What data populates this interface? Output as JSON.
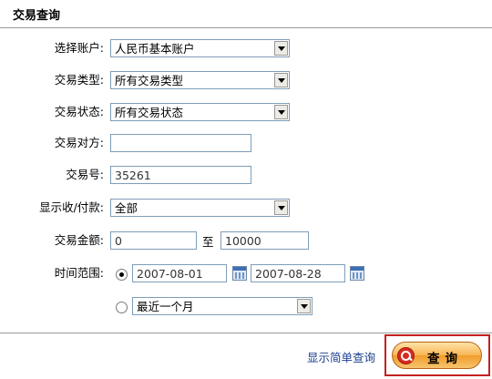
{
  "header": {
    "title": "交易查询"
  },
  "form": {
    "account": {
      "label": "选择账户:",
      "value": "人民币基本账户"
    },
    "trade_type": {
      "label": "交易类型:",
      "value": "所有交易类型"
    },
    "trade_status": {
      "label": "交易状态:",
      "value": "所有交易状态"
    },
    "counterparty": {
      "label": "交易对方:",
      "value": ""
    },
    "trade_no": {
      "label": "交易号:",
      "value": "35261"
    },
    "direction": {
      "label": "显示收/付款:",
      "value": "全部"
    },
    "amount": {
      "label": "交易金额:",
      "min": "0",
      "to": "至",
      "max": "10000"
    },
    "time_range": {
      "label": "时间范围:",
      "start_date": "2007-08-01",
      "end_date": "2007-08-28",
      "preset": "最近一个月",
      "selected": "date_range"
    }
  },
  "footer": {
    "simple_query_link": "显示简单查询",
    "query_button": "查询"
  },
  "colors": {
    "button_orange": "#f9b656",
    "button_outline_red": "#c62020",
    "link_blue": "#1a3c8f",
    "field_border": "#7f9db9"
  }
}
